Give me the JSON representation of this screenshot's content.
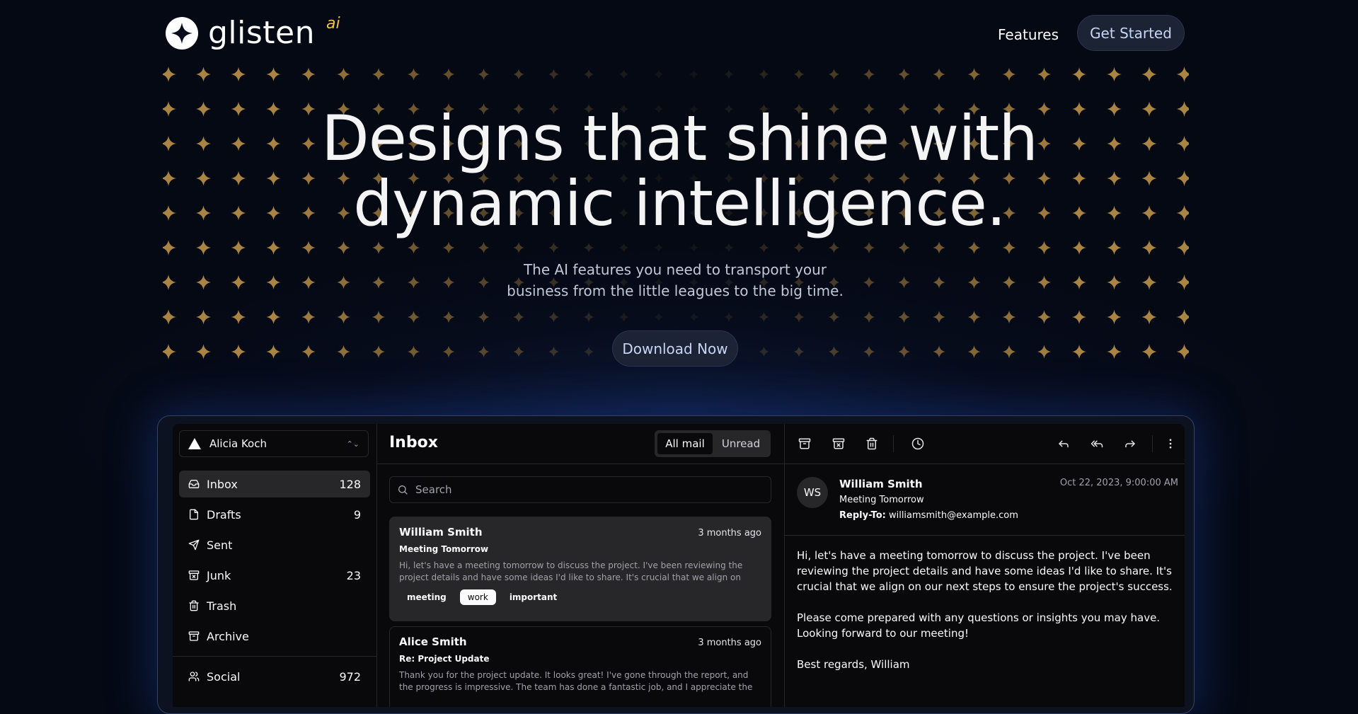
{
  "brand": {
    "name": "glisten",
    "suffix": "ai",
    "accent": "#f0c04a"
  },
  "nav": {
    "features": "Features",
    "get_started": "Get Started"
  },
  "hero": {
    "title_line1": "Designs that shine with",
    "title_line2": "dynamic intelligence.",
    "subtitle_line1": "The AI features you need to transport your",
    "subtitle_line2": "business from the little leagues to the big time.",
    "cta": "Download Now"
  },
  "app": {
    "account": {
      "name": "Alicia Koch"
    },
    "sidebar": {
      "items": [
        {
          "label": "Inbox",
          "count": "128",
          "icon": "inbox-icon"
        },
        {
          "label": "Drafts",
          "count": "9",
          "icon": "file-icon"
        },
        {
          "label": "Sent",
          "count": "",
          "icon": "send-icon"
        },
        {
          "label": "Junk",
          "count": "23",
          "icon": "archive-x-icon"
        },
        {
          "label": "Trash",
          "count": "",
          "icon": "trash-icon"
        },
        {
          "label": "Archive",
          "count": "",
          "icon": "archive-icon"
        },
        {
          "label": "Social",
          "count": "972",
          "icon": "users-icon"
        }
      ]
    },
    "list": {
      "title": "Inbox",
      "tabs": [
        "All mail",
        "Unread"
      ],
      "search_placeholder": "Search",
      "mails": [
        {
          "from": "William Smith",
          "date": "3 months ago",
          "subject": "Meeting Tomorrow",
          "preview": "Hi, let's have a meeting tomorrow to discuss the project. I've been reviewing the project details and have some ideas I'd like to share. It's crucial that we align on our…",
          "labels": [
            "meeting",
            "work",
            "important"
          ]
        },
        {
          "from": "Alice Smith",
          "date": "3 months ago",
          "subject": "Re: Project Update",
          "preview": "Thank you for the project update. It looks great! I've gone through the report, and the progress is impressive. The team has done a fantastic job, and I appreciate the hard…"
        }
      ]
    },
    "detail": {
      "initials": "WS",
      "from": "William Smith",
      "subject": "Meeting Tomorrow",
      "reply_to_label": "Reply-To:",
      "reply_to": "williamsmith@example.com",
      "date": "Oct 22, 2023, 9:00:00 AM",
      "body": [
        "Hi, let's have a meeting tomorrow to discuss the project. I've been reviewing the project details and have some ideas I'd like to share. It's crucial that we align on our next steps to ensure the project's success.",
        "Please come prepared with any questions or insights you may have. Looking forward to our meeting!",
        "Best regards, William"
      ]
    }
  }
}
